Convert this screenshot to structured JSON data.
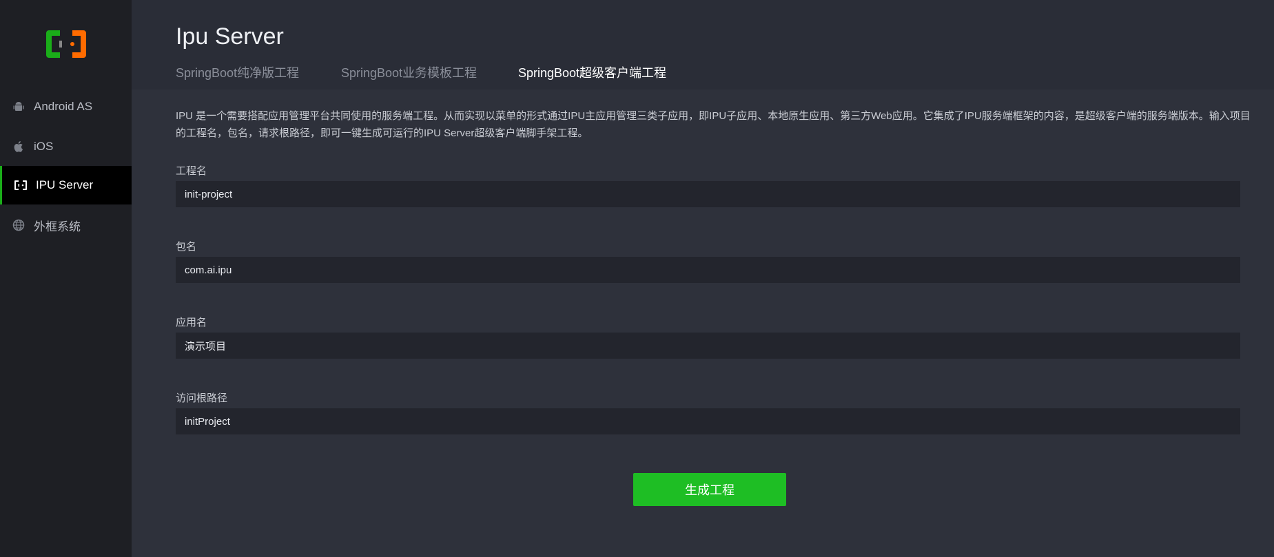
{
  "sidebar": {
    "items": [
      {
        "label": "Android AS",
        "icon": "android-icon"
      },
      {
        "label": "iOS",
        "icon": "apple-icon"
      },
      {
        "label": "IPU Server",
        "icon": "ipu-icon"
      },
      {
        "label": "外框系统",
        "icon": "globe-icon"
      }
    ],
    "active_index": 2
  },
  "header": {
    "title": "Ipu Server",
    "tabs": [
      {
        "label": "SpringBoot纯净版工程"
      },
      {
        "label": "SpringBoot业务模板工程"
      },
      {
        "label": "SpringBoot超级客户端工程"
      }
    ],
    "active_tab": 2
  },
  "main": {
    "description": "IPU 是一个需要搭配应用管理平台共同使用的服务端工程。从而实现以菜单的形式通过IPU主应用管理三类子应用，即IPU子应用、本地原生应用、第三方Web应用。它集成了IPU服务端框架的内容，是超级客户端的服务端版本。输入项目的工程名，包名，请求根路径，即可一键生成可运行的IPU Server超级客户端脚手架工程。",
    "fields": [
      {
        "label": "工程名",
        "value": "init-project"
      },
      {
        "label": "包名",
        "value": "com.ai.ipu"
      },
      {
        "label": "应用名",
        "value": "演示项目"
      },
      {
        "label": "访问根路径",
        "value": "initProject"
      }
    ],
    "submit_label": "生成工程"
  },
  "colors": {
    "accent": "#1aad19",
    "button": "#1ebe24",
    "logo_green": "#1aad19",
    "logo_orange": "#ff6b00"
  }
}
